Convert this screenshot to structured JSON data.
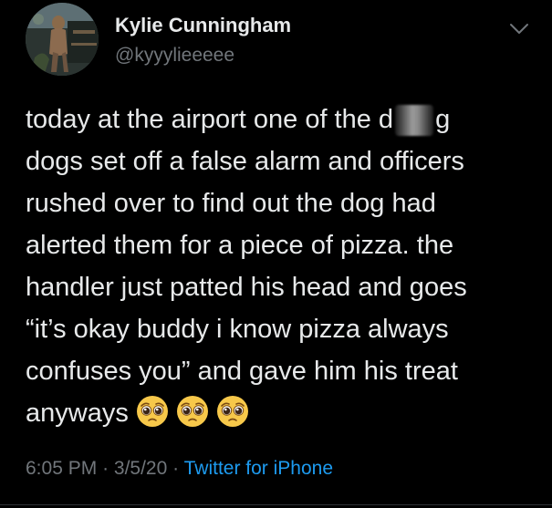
{
  "author": {
    "name": "Kylie Cunningham",
    "handle": "@kyyylieeeee"
  },
  "tweet": {
    "lines": [
      {
        "before": "today at the airport one of the d",
        "after": "g",
        "redacted": true
      },
      {
        "text": "dogs set off a false alarm and officers"
      },
      {
        "text": "rushed over to find out the dog had"
      },
      {
        "text": "alerted them for a piece of pizza. the"
      },
      {
        "text": "handler just patted his head and goes"
      },
      {
        "text": "“it’s okay buddy i know pizza always"
      },
      {
        "text": "confuses you” and gave him his treat"
      },
      {
        "text": "anyways",
        "emojis": [
          "pleading-face-emoji",
          "pleading-face-emoji",
          "pleading-face-emoji"
        ]
      }
    ]
  },
  "meta": {
    "time": "6:05 PM",
    "separator": "·",
    "date": "3/5/20",
    "source": "Twitter for iPhone"
  },
  "colors": {
    "background": "#000000",
    "text": "#e7e9ea",
    "muted": "#71767b",
    "link": "#1d9bf0"
  }
}
